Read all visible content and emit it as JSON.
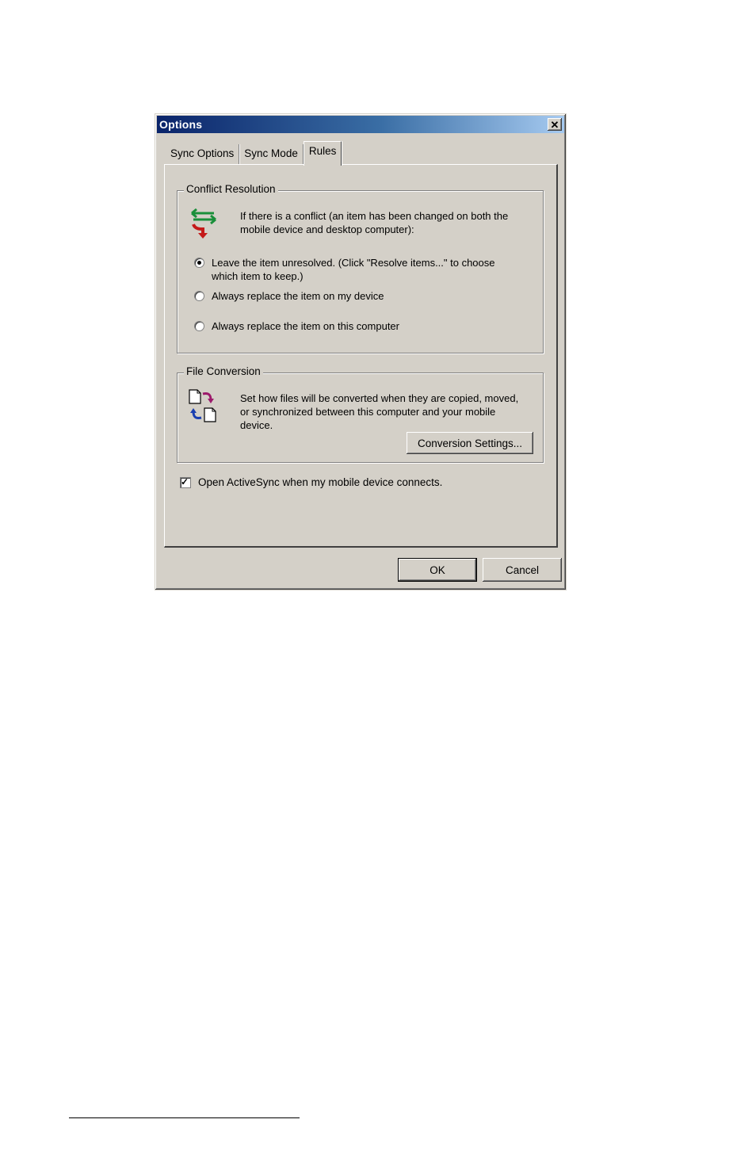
{
  "dialog": {
    "title": "Options",
    "close_glyph": "✕"
  },
  "tabs": [
    {
      "label": "Sync Options",
      "active": false
    },
    {
      "label": "Sync Mode",
      "active": false
    },
    {
      "label": "Rules",
      "active": true
    }
  ],
  "conflict": {
    "group_label": "Conflict Resolution",
    "description": "If there is a conflict (an item has been changed on both the mobile device and desktop computer):",
    "icon": "sync-arrows-icon",
    "options": [
      {
        "label": "Leave the item unresolved. (Click \"Resolve items...\" to choose which item to keep.)",
        "checked": true
      },
      {
        "label": "Always replace the item on my device",
        "checked": false
      },
      {
        "label": "Always replace the item on this computer",
        "checked": false
      }
    ]
  },
  "file_conversion": {
    "group_label": "File Conversion",
    "description": "Set how files will be converted when they are copied, moved, or synchronized between this computer and your mobile device.",
    "icon": "file-convert-icon",
    "button_label": "Conversion Settings..."
  },
  "open_activesync": {
    "label": "Open ActiveSync when my mobile device connects.",
    "checked": true,
    "tick": "✓"
  },
  "buttons": {
    "ok": "OK",
    "cancel": "Cancel"
  },
  "colors": {
    "dialog_face": "#d4d0c8",
    "titlebar_start": "#0a246a",
    "titlebar_end": "#a6caf0"
  }
}
